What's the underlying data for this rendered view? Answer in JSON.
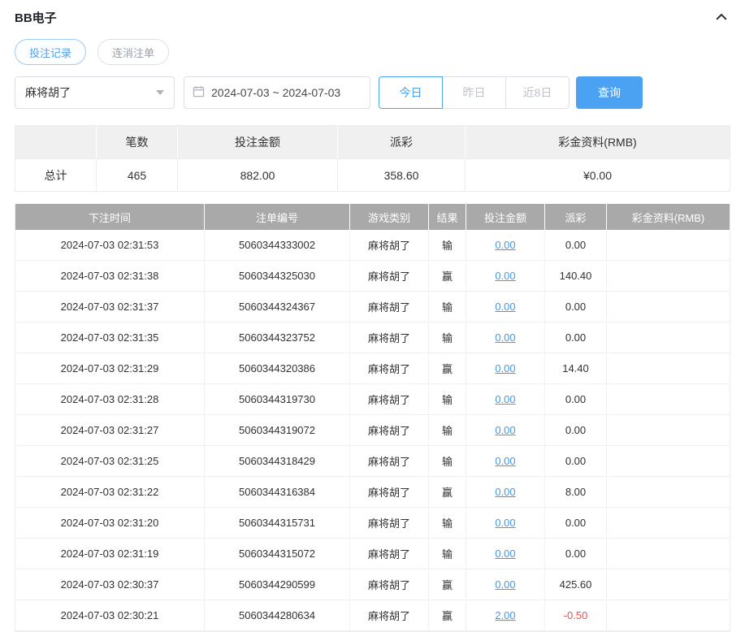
{
  "colors": {
    "accent": "#4ba2f2",
    "link": "#3d9aee",
    "negative": "#f04f4f",
    "thead-bg": "#a9a9a9"
  },
  "header": {
    "title": "BB电子"
  },
  "tabs": [
    {
      "label": "投注记录"
    },
    {
      "label": "连消注单"
    }
  ],
  "filters": {
    "game_select": {
      "value": "麻将胡了"
    },
    "date_range": {
      "value": "2024-07-03 ~ 2024-07-03"
    },
    "quick": [
      {
        "label": "今日"
      },
      {
        "label": "昨日"
      },
      {
        "label": "近8日"
      }
    ],
    "query_label": "查询"
  },
  "summary": {
    "headers": [
      "",
      "笔数",
      "投注金额",
      "派彩",
      "彩金资料(RMB)"
    ],
    "total": {
      "label": "总计",
      "count": "465",
      "bet": "882.00",
      "payout": "358.60",
      "bonus": "¥0.00"
    }
  },
  "table": {
    "headers": [
      "下注时间",
      "注单编号",
      "游戏类别",
      "结果",
      "投注金额",
      "派彩",
      "彩金资料(RMB)"
    ],
    "rows": [
      {
        "time": "2024-07-03 02:31:53",
        "order": "5060344333002",
        "game": "麻将胡了",
        "result": "输",
        "bet": "0.00",
        "payout": "0.00",
        "bonus": ""
      },
      {
        "time": "2024-07-03 02:31:38",
        "order": "5060344325030",
        "game": "麻将胡了",
        "result": "赢",
        "bet": "0.00",
        "payout": "140.40",
        "bonus": ""
      },
      {
        "time": "2024-07-03 02:31:37",
        "order": "5060344324367",
        "game": "麻将胡了",
        "result": "输",
        "bet": "0.00",
        "payout": "0.00",
        "bonus": ""
      },
      {
        "time": "2024-07-03 02:31:35",
        "order": "5060344323752",
        "game": "麻将胡了",
        "result": "输",
        "bet": "0.00",
        "payout": "0.00",
        "bonus": ""
      },
      {
        "time": "2024-07-03 02:31:29",
        "order": "5060344320386",
        "game": "麻将胡了",
        "result": "赢",
        "bet": "0.00",
        "payout": "14.40",
        "bonus": ""
      },
      {
        "time": "2024-07-03 02:31:28",
        "order": "5060344319730",
        "game": "麻将胡了",
        "result": "输",
        "bet": "0.00",
        "payout": "0.00",
        "bonus": ""
      },
      {
        "time": "2024-07-03 02:31:27",
        "order": "5060344319072",
        "game": "麻将胡了",
        "result": "输",
        "bet": "0.00",
        "payout": "0.00",
        "bonus": ""
      },
      {
        "time": "2024-07-03 02:31:25",
        "order": "5060344318429",
        "game": "麻将胡了",
        "result": "输",
        "bet": "0.00",
        "payout": "0.00",
        "bonus": ""
      },
      {
        "time": "2024-07-03 02:31:22",
        "order": "5060344316384",
        "game": "麻将胡了",
        "result": "赢",
        "bet": "0.00",
        "payout": "8.00",
        "bonus": ""
      },
      {
        "time": "2024-07-03 02:31:20",
        "order": "5060344315731",
        "game": "麻将胡了",
        "result": "输",
        "bet": "0.00",
        "payout": "0.00",
        "bonus": ""
      },
      {
        "time": "2024-07-03 02:31:19",
        "order": "5060344315072",
        "game": "麻将胡了",
        "result": "输",
        "bet": "0.00",
        "payout": "0.00",
        "bonus": ""
      },
      {
        "time": "2024-07-03 02:30:37",
        "order": "5060344290599",
        "game": "麻将胡了",
        "result": "赢",
        "bet": "0.00",
        "payout": "425.60",
        "bonus": ""
      },
      {
        "time": "2024-07-03 02:30:21",
        "order": "5060344280634",
        "game": "麻将胡了",
        "result": "赢",
        "bet": "2.00",
        "payout": "-0.50",
        "bonus": ""
      }
    ]
  }
}
